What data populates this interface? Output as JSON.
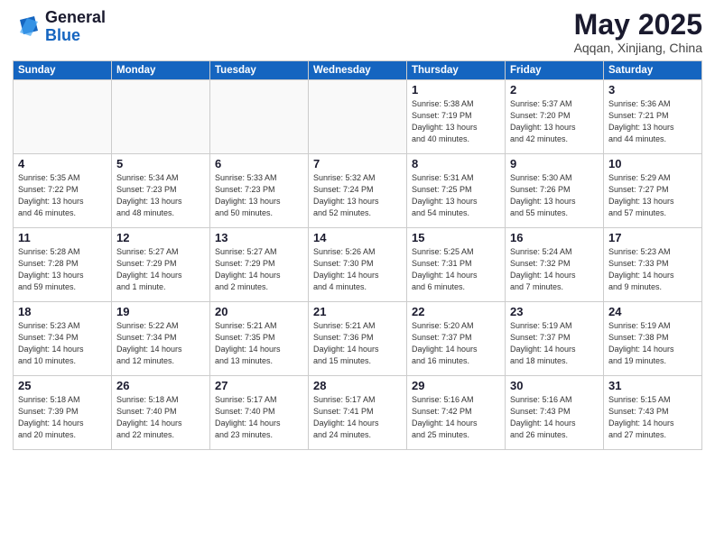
{
  "header": {
    "logo_general": "General",
    "logo_blue": "Blue",
    "month_title": "May 2025",
    "location": "Aqqan, Xinjiang, China"
  },
  "weekdays": [
    "Sunday",
    "Monday",
    "Tuesday",
    "Wednesday",
    "Thursday",
    "Friday",
    "Saturday"
  ],
  "weeks": [
    [
      {
        "day": "",
        "info": ""
      },
      {
        "day": "",
        "info": ""
      },
      {
        "day": "",
        "info": ""
      },
      {
        "day": "",
        "info": ""
      },
      {
        "day": "1",
        "info": "Sunrise: 5:38 AM\nSunset: 7:19 PM\nDaylight: 13 hours\nand 40 minutes."
      },
      {
        "day": "2",
        "info": "Sunrise: 5:37 AM\nSunset: 7:20 PM\nDaylight: 13 hours\nand 42 minutes."
      },
      {
        "day": "3",
        "info": "Sunrise: 5:36 AM\nSunset: 7:21 PM\nDaylight: 13 hours\nand 44 minutes."
      }
    ],
    [
      {
        "day": "4",
        "info": "Sunrise: 5:35 AM\nSunset: 7:22 PM\nDaylight: 13 hours\nand 46 minutes."
      },
      {
        "day": "5",
        "info": "Sunrise: 5:34 AM\nSunset: 7:23 PM\nDaylight: 13 hours\nand 48 minutes."
      },
      {
        "day": "6",
        "info": "Sunrise: 5:33 AM\nSunset: 7:23 PM\nDaylight: 13 hours\nand 50 minutes."
      },
      {
        "day": "7",
        "info": "Sunrise: 5:32 AM\nSunset: 7:24 PM\nDaylight: 13 hours\nand 52 minutes."
      },
      {
        "day": "8",
        "info": "Sunrise: 5:31 AM\nSunset: 7:25 PM\nDaylight: 13 hours\nand 54 minutes."
      },
      {
        "day": "9",
        "info": "Sunrise: 5:30 AM\nSunset: 7:26 PM\nDaylight: 13 hours\nand 55 minutes."
      },
      {
        "day": "10",
        "info": "Sunrise: 5:29 AM\nSunset: 7:27 PM\nDaylight: 13 hours\nand 57 minutes."
      }
    ],
    [
      {
        "day": "11",
        "info": "Sunrise: 5:28 AM\nSunset: 7:28 PM\nDaylight: 13 hours\nand 59 minutes."
      },
      {
        "day": "12",
        "info": "Sunrise: 5:27 AM\nSunset: 7:29 PM\nDaylight: 14 hours\nand 1 minute."
      },
      {
        "day": "13",
        "info": "Sunrise: 5:27 AM\nSunset: 7:29 PM\nDaylight: 14 hours\nand 2 minutes."
      },
      {
        "day": "14",
        "info": "Sunrise: 5:26 AM\nSunset: 7:30 PM\nDaylight: 14 hours\nand 4 minutes."
      },
      {
        "day": "15",
        "info": "Sunrise: 5:25 AM\nSunset: 7:31 PM\nDaylight: 14 hours\nand 6 minutes."
      },
      {
        "day": "16",
        "info": "Sunrise: 5:24 AM\nSunset: 7:32 PM\nDaylight: 14 hours\nand 7 minutes."
      },
      {
        "day": "17",
        "info": "Sunrise: 5:23 AM\nSunset: 7:33 PM\nDaylight: 14 hours\nand 9 minutes."
      }
    ],
    [
      {
        "day": "18",
        "info": "Sunrise: 5:23 AM\nSunset: 7:34 PM\nDaylight: 14 hours\nand 10 minutes."
      },
      {
        "day": "19",
        "info": "Sunrise: 5:22 AM\nSunset: 7:34 PM\nDaylight: 14 hours\nand 12 minutes."
      },
      {
        "day": "20",
        "info": "Sunrise: 5:21 AM\nSunset: 7:35 PM\nDaylight: 14 hours\nand 13 minutes."
      },
      {
        "day": "21",
        "info": "Sunrise: 5:21 AM\nSunset: 7:36 PM\nDaylight: 14 hours\nand 15 minutes."
      },
      {
        "day": "22",
        "info": "Sunrise: 5:20 AM\nSunset: 7:37 PM\nDaylight: 14 hours\nand 16 minutes."
      },
      {
        "day": "23",
        "info": "Sunrise: 5:19 AM\nSunset: 7:37 PM\nDaylight: 14 hours\nand 18 minutes."
      },
      {
        "day": "24",
        "info": "Sunrise: 5:19 AM\nSunset: 7:38 PM\nDaylight: 14 hours\nand 19 minutes."
      }
    ],
    [
      {
        "day": "25",
        "info": "Sunrise: 5:18 AM\nSunset: 7:39 PM\nDaylight: 14 hours\nand 20 minutes."
      },
      {
        "day": "26",
        "info": "Sunrise: 5:18 AM\nSunset: 7:40 PM\nDaylight: 14 hours\nand 22 minutes."
      },
      {
        "day": "27",
        "info": "Sunrise: 5:17 AM\nSunset: 7:40 PM\nDaylight: 14 hours\nand 23 minutes."
      },
      {
        "day": "28",
        "info": "Sunrise: 5:17 AM\nSunset: 7:41 PM\nDaylight: 14 hours\nand 24 minutes."
      },
      {
        "day": "29",
        "info": "Sunrise: 5:16 AM\nSunset: 7:42 PM\nDaylight: 14 hours\nand 25 minutes."
      },
      {
        "day": "30",
        "info": "Sunrise: 5:16 AM\nSunset: 7:43 PM\nDaylight: 14 hours\nand 26 minutes."
      },
      {
        "day": "31",
        "info": "Sunrise: 5:15 AM\nSunset: 7:43 PM\nDaylight: 14 hours\nand 27 minutes."
      }
    ]
  ]
}
